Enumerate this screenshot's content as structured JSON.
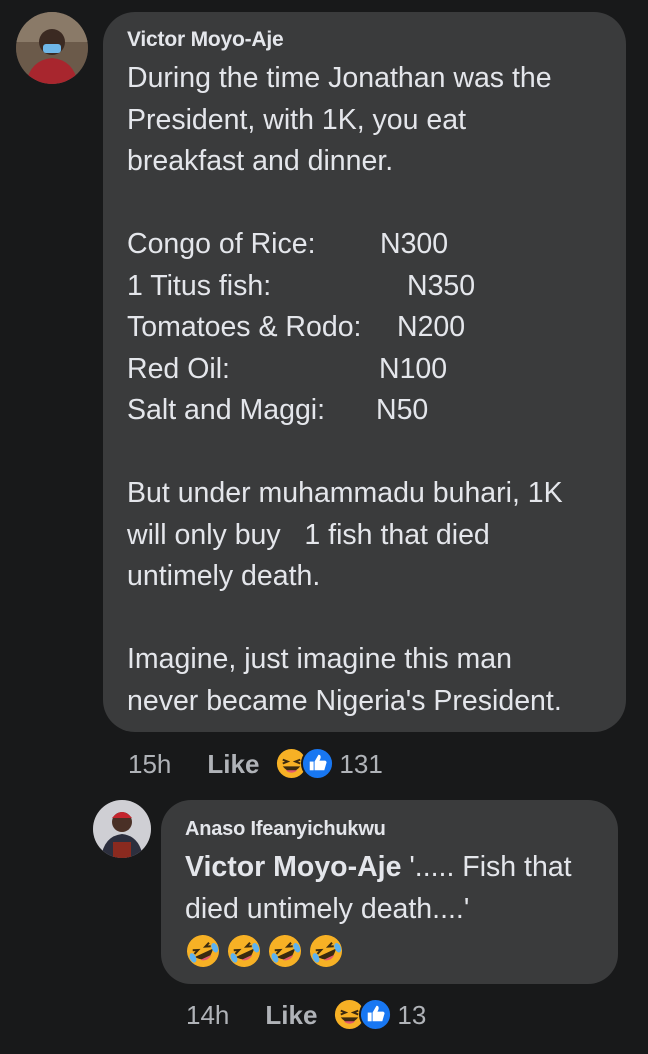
{
  "comment": {
    "author": "Victor Moyo-Aje",
    "intro_lines": [
      "During the time Jonathan was the",
      "President, with 1K, you eat",
      "breakfast and dinner."
    ],
    "price_list": [
      {
        "item": "Congo of Rice:",
        "price": "N300"
      },
      {
        "item": "1 Titus fish:",
        "price": "N350"
      },
      {
        "item": "Tomatoes & Rodo:",
        "price": "N200"
      },
      {
        "item": "Red Oil:",
        "price": "N100"
      },
      {
        "item": "Salt and Maggi:",
        "price": "N50"
      }
    ],
    "middle_lines": [
      "But under muhammadu buhari, 1K",
      "will only buy   1 fish that died",
      "untimely death."
    ],
    "closing_lines": [
      "Imagine, just imagine this man",
      "never became Nigeria's President."
    ],
    "time": "15h",
    "like_label": "Like",
    "reaction_icons": [
      "laughing-emoji",
      "like-thumb"
    ],
    "reaction_count": "131"
  },
  "reply": {
    "author": "Anaso Ifeanyichukwu",
    "tag": "Victor Moyo-Aje",
    "line1": " '..... Fish that",
    "line2": "died untimely death....'",
    "emojis": [
      "rofl-emoji",
      "rofl-emoji",
      "rofl-emoji",
      "rofl-emoji"
    ],
    "time": "14h",
    "like_label": "Like",
    "reaction_icons": [
      "laughing-emoji",
      "like-thumb"
    ],
    "reaction_count": "13"
  },
  "colors": {
    "background": "#18191a",
    "bubble": "#3a3b3c",
    "text": "#e4e6eb",
    "meta": "#b0b3b8",
    "like_blue": "#1877f2",
    "emoji_yellow": "#f7b125"
  }
}
